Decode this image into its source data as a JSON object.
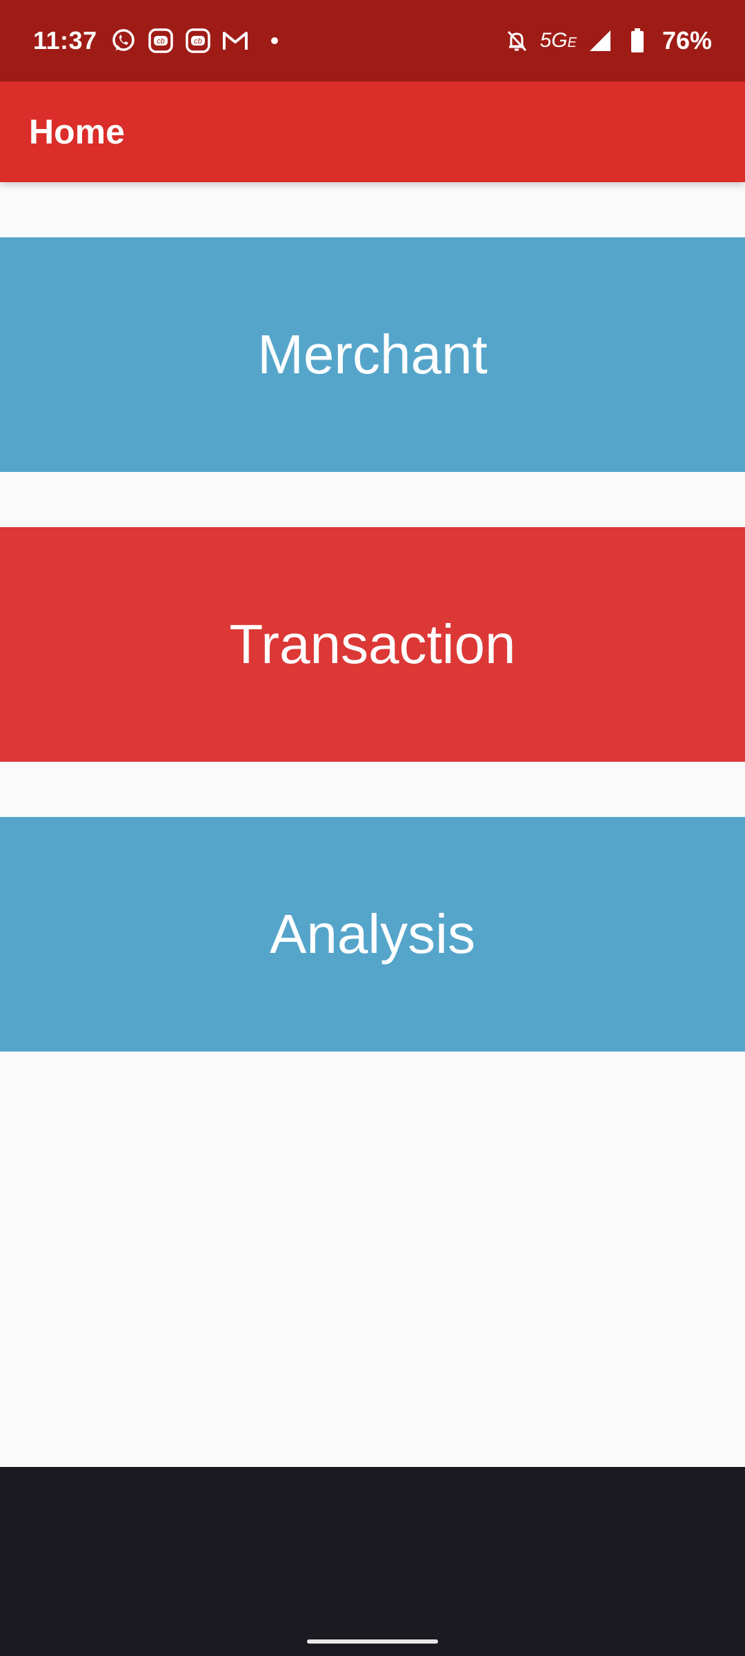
{
  "status_bar": {
    "time": "11:37",
    "notification_icons": [
      "whatsapp-icon",
      "cb-app-icon",
      "cb-app-icon",
      "gmail-icon"
    ],
    "network": "5G",
    "network_suffix": "E",
    "battery_percent": "76%"
  },
  "app_bar": {
    "title": "Home"
  },
  "tiles": [
    {
      "label": "Merchant",
      "color": "#55a5cb"
    },
    {
      "label": "Transaction",
      "color": "#dc3836"
    },
    {
      "label": "Analysis",
      "color": "#55a5cb"
    }
  ],
  "theme": {
    "status_bar_color": "#9f1c16",
    "app_bar_color": "#db2d2a",
    "background": "#fafafa",
    "nav_bar_color": "#1c1a21"
  }
}
